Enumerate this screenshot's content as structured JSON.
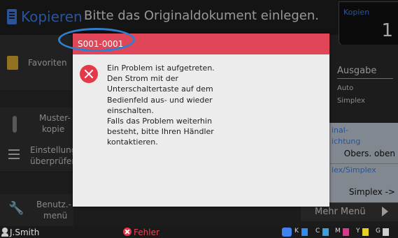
{
  "header": {
    "app_title": "Kopieren",
    "message": "Bitte das Originaldokument einlegen.",
    "copies_label": "Kopien",
    "copies_value": "1"
  },
  "left_menu": {
    "favorites": "Favoriten",
    "sample_line1": "Muster-",
    "sample_line2": "kopie",
    "check_line1": "Einstellung",
    "check_line2": "überprüfen",
    "user_menu_line1": "Benutz.-",
    "user_menu_line2": "menü"
  },
  "right_panel": {
    "output_title": "Ausgabe",
    "output_line1": "Auto",
    "output_line2": "Simplex",
    "orig_label_line1": "inal-",
    "orig_label_line2": "ichtung",
    "orig_value": "Obers. oben",
    "duplex_label": "lex/Simplex",
    "duplex_value": "Simplex ->",
    "more_menu": "Mehr Menü"
  },
  "dialog": {
    "code": "S001-0001",
    "icon": "error-icon",
    "lines": [
      "Ein Problem ist aufgetreten.",
      "Den Strom mit der",
      "Unterschaltertaste auf dem",
      "Bedienfeld aus- und wieder",
      "einschalten.",
      "Falls das Problem weiterhin",
      "besteht, bitte Ihren Händler",
      "kontaktieren."
    ]
  },
  "status_bar": {
    "user": "J.Smith",
    "error_text": "Fehler",
    "ink": [
      {
        "label": "K",
        "color": "#1e90ff"
      },
      {
        "label": "C",
        "color": "#3aa0e0"
      },
      {
        "label": "M",
        "color": "#d63a8a"
      },
      {
        "label": "Y",
        "color": "#e8d020"
      },
      {
        "label": "G",
        "color": "#cfcfcf"
      }
    ]
  },
  "colors": {
    "accent": "#3f82f0",
    "error": "#e04657",
    "highlight": "#2f7fd0"
  }
}
